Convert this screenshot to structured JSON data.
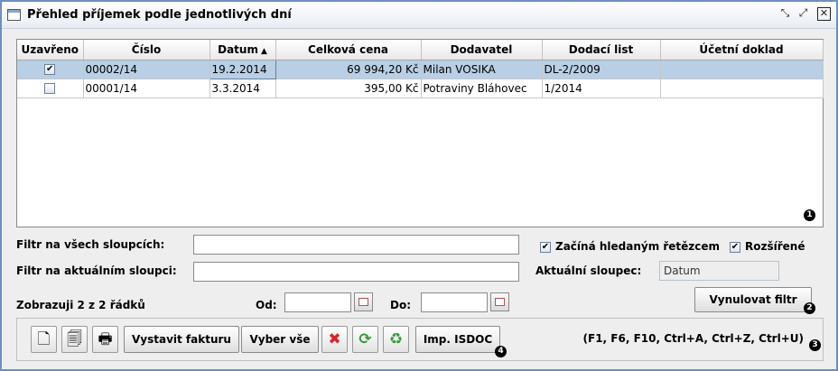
{
  "window": {
    "title": "Přehled příjemek podle jednotlivých dní",
    "controls": [
      "minimize-icon",
      "maximize-icon",
      "close-icon"
    ]
  },
  "table": {
    "columns": [
      "Uzavřeno",
      "Číslo",
      "Datum",
      "Celková cena",
      "Dodavatel",
      "Dodací list",
      "Účetní doklad"
    ],
    "sort_column": "Datum",
    "sort_direction": "ascending",
    "rows": [
      {
        "closed": "✔",
        "cislo": "00002/14",
        "datum": "19.2.2014",
        "cena": "69 994,20 Kč",
        "dodavatel": "Milan VOSIKA",
        "dodaci_list": "DL-2/2009",
        "ucetni_doklad": ""
      },
      {
        "closed": "",
        "cislo": "00001/14",
        "datum": "3.3.2014",
        "cena": "395,00 Kč",
        "dodavatel": "Potraviny Bláhovec",
        "dodaci_list": "1/2014",
        "ucetni_doklad": ""
      }
    ],
    "selected_row": 0
  },
  "badges": {
    "b1": "1",
    "b2": "2",
    "b3": "3",
    "b4": "4"
  },
  "filters": {
    "all_columns_label": "Filtr na všech sloupcích:",
    "all_columns_value": "",
    "current_column_label": "Filtr na aktuálním sloupci:",
    "current_column_value": "",
    "starts_with_label": "Začíná hledaným řetězcem",
    "starts_with_checked": "✔",
    "extended_label": "Rozšířené",
    "extended_checked": "✔",
    "current_col_caption": "Aktuální sloupec:",
    "current_col_value": "Datum",
    "showing_text": "Zobrazuji 2 z 2 řádků",
    "od_label": "Od:",
    "do_label": "Do:",
    "reset_label": "Vynulovat filtr"
  },
  "toolbar": {
    "new_icon": "new-document-icon",
    "copy_icon": "copy-document-icon",
    "print_icon": "print-preview-icon",
    "invoice_label": "Vystavit fakturu",
    "select_all_label": "Vyber vše",
    "delete_icon": "delete-icon",
    "refresh_icon": "refresh-icon",
    "trash_icon": "recycle-bin-icon",
    "isdoc_label": "Imp. ISDOC",
    "shortcuts": "(F1, F6, F10, Ctrl+A, Ctrl+Z, Ctrl+U)"
  },
  "colors": {
    "selected_row": "#b8cfe5",
    "window_border": "#6d8fbf",
    "delete": "#d9262b",
    "refresh": "#3a9a3a"
  }
}
